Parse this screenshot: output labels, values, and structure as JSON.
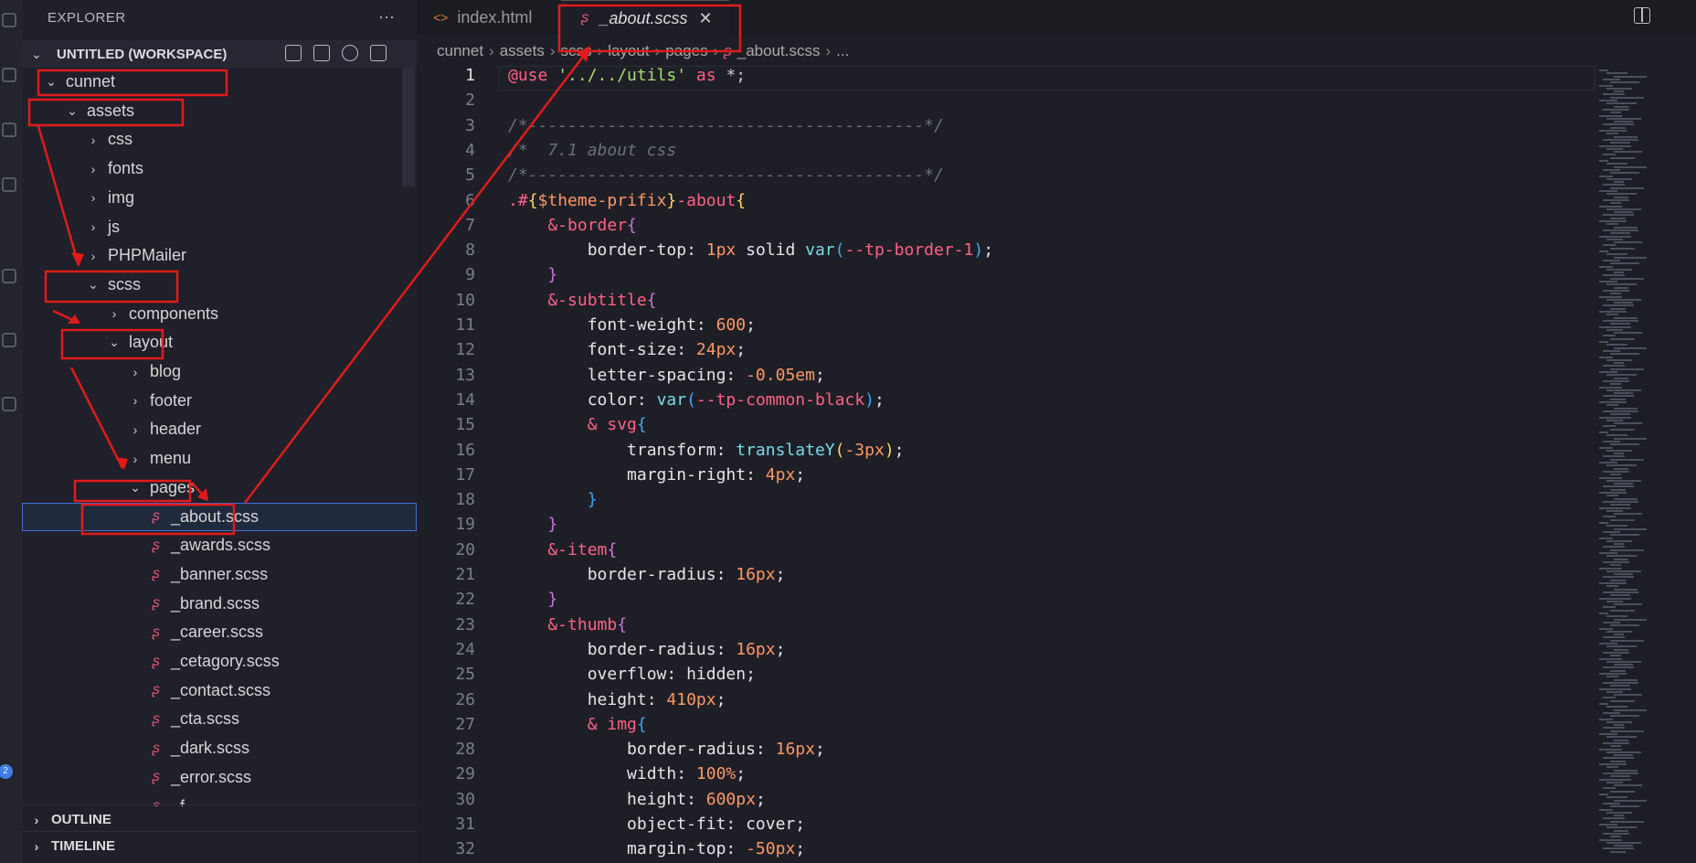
{
  "sidebar": {
    "title": "EXPLORER",
    "more": "···",
    "workspace": "UNTITLED (WORKSPACE)",
    "tree": [
      {
        "label": "cunnet",
        "type": "folder",
        "open": true,
        "depth": 0
      },
      {
        "label": "assets",
        "type": "folder",
        "open": true,
        "depth": 1
      },
      {
        "label": "css",
        "type": "folder",
        "open": false,
        "depth": 2
      },
      {
        "label": "fonts",
        "type": "folder",
        "open": false,
        "depth": 2
      },
      {
        "label": "img",
        "type": "folder",
        "open": false,
        "depth": 2
      },
      {
        "label": "js",
        "type": "folder",
        "open": false,
        "depth": 2
      },
      {
        "label": "PHPMailer",
        "type": "folder",
        "open": false,
        "depth": 2
      },
      {
        "label": "scss",
        "type": "folder",
        "open": true,
        "depth": 2
      },
      {
        "label": "components",
        "type": "folder",
        "open": false,
        "depth": 3
      },
      {
        "label": "layout",
        "type": "folder",
        "open": true,
        "depth": 3
      },
      {
        "label": "blog",
        "type": "folder",
        "open": false,
        "depth": 4
      },
      {
        "label": "footer",
        "type": "folder",
        "open": false,
        "depth": 4
      },
      {
        "label": "header",
        "type": "folder",
        "open": false,
        "depth": 4
      },
      {
        "label": "menu",
        "type": "folder",
        "open": false,
        "depth": 4
      },
      {
        "label": "pages",
        "type": "folder",
        "open": true,
        "depth": 4
      },
      {
        "label": "_about.scss",
        "type": "file",
        "depth": 5,
        "selected": true
      },
      {
        "label": "_awards.scss",
        "type": "file",
        "depth": 5
      },
      {
        "label": "_banner.scss",
        "type": "file",
        "depth": 5
      },
      {
        "label": "_brand.scss",
        "type": "file",
        "depth": 5
      },
      {
        "label": "_career.scss",
        "type": "file",
        "depth": 5
      },
      {
        "label": "_cetagory.scss",
        "type": "file",
        "depth": 5
      },
      {
        "label": "_contact.scss",
        "type": "file",
        "depth": 5
      },
      {
        "label": "_cta.scss",
        "type": "file",
        "depth": 5
      },
      {
        "label": "_dark.scss",
        "type": "file",
        "depth": 5
      },
      {
        "label": "_error.scss",
        "type": "file",
        "depth": 5
      },
      {
        "label": "_f...",
        "type": "file",
        "depth": 5
      }
    ],
    "outline": "OUTLINE",
    "timeline": "TIMELINE",
    "badge": "2"
  },
  "tabs": [
    {
      "label": "index.html",
      "active": false,
      "icon": "html-icon"
    },
    {
      "label": "_about.scss",
      "active": true,
      "icon": "sass-icon"
    }
  ],
  "breadcrumb": [
    "cunnet",
    "assets",
    "scss",
    "layout",
    "pages",
    "_about.scss",
    "..."
  ],
  "editor": {
    "lines": [
      [
        [
          "@use ",
          "c-at"
        ],
        [
          "'../../utils'",
          "c-str"
        ],
        [
          " as ",
          "c-kw"
        ],
        [
          "*",
          "c-op"
        ],
        [
          ";",
          "c-op"
        ]
      ],
      [],
      [
        [
          "/*----------------------------------------*/",
          "c-com"
        ]
      ],
      [
        [
          "/*  7.1 about css",
          "c-com"
        ]
      ],
      [
        [
          "/*----------------------------------------*/",
          "c-com"
        ]
      ],
      [
        [
          ".#",
          "c-sel"
        ],
        [
          "{",
          "c-brace"
        ],
        [
          "$theme-prifix",
          "c-var"
        ],
        [
          "}",
          "c-brace"
        ],
        [
          "-about",
          "c-sel"
        ],
        [
          "{",
          "c-brace"
        ]
      ],
      [
        [
          "    &-border",
          "c-sel"
        ],
        [
          "{",
          "c-brace2"
        ]
      ],
      [
        [
          "        border-top: ",
          "c-prop"
        ],
        [
          "1px",
          "c-num"
        ],
        [
          " solid ",
          "c-prop"
        ],
        [
          "var",
          "c-fn"
        ],
        [
          "(",
          "c-brace3"
        ],
        [
          "--tp-border-1",
          "c-sel"
        ],
        [
          ")",
          "c-brace3"
        ],
        [
          ";",
          "c-prop"
        ]
      ],
      [
        [
          "    ",
          "c-prop"
        ],
        [
          "}",
          "c-brace2"
        ]
      ],
      [
        [
          "    &-subtitle",
          "c-sel"
        ],
        [
          "{",
          "c-brace2"
        ]
      ],
      [
        [
          "        font-weight: ",
          "c-prop"
        ],
        [
          "600",
          "c-num"
        ],
        [
          ";",
          "c-prop"
        ]
      ],
      [
        [
          "        font-size: ",
          "c-prop"
        ],
        [
          "24px",
          "c-num"
        ],
        [
          ";",
          "c-prop"
        ]
      ],
      [
        [
          "        letter-spacing: ",
          "c-prop"
        ],
        [
          "-0.05em",
          "c-num"
        ],
        [
          ";",
          "c-prop"
        ]
      ],
      [
        [
          "        color: ",
          "c-prop"
        ],
        [
          "var",
          "c-fn"
        ],
        [
          "(",
          "c-brace3"
        ],
        [
          "--tp-common-black",
          "c-sel"
        ],
        [
          ")",
          "c-brace3"
        ],
        [
          ";",
          "c-prop"
        ]
      ],
      [
        [
          "        & svg",
          "c-sel"
        ],
        [
          "{",
          "c-brace3"
        ]
      ],
      [
        [
          "            transform: ",
          "c-prop"
        ],
        [
          "translateY",
          "c-fn"
        ],
        [
          "(",
          "c-brace"
        ],
        [
          "-3px",
          "c-num"
        ],
        [
          ")",
          "c-brace"
        ],
        [
          ";",
          "c-prop"
        ]
      ],
      [
        [
          "            margin-right: ",
          "c-prop"
        ],
        [
          "4px",
          "c-num"
        ],
        [
          ";",
          "c-prop"
        ]
      ],
      [
        [
          "        ",
          "c-prop"
        ],
        [
          "}",
          "c-brace3"
        ]
      ],
      [
        [
          "    ",
          "c-prop"
        ],
        [
          "}",
          "c-brace2"
        ]
      ],
      [
        [
          "    &-item",
          "c-sel"
        ],
        [
          "{",
          "c-brace2"
        ]
      ],
      [
        [
          "        border-radius: ",
          "c-prop"
        ],
        [
          "16px",
          "c-num"
        ],
        [
          ";",
          "c-prop"
        ]
      ],
      [
        [
          "    ",
          "c-prop"
        ],
        [
          "}",
          "c-brace2"
        ]
      ],
      [
        [
          "    &-thumb",
          "c-sel"
        ],
        [
          "{",
          "c-brace2"
        ]
      ],
      [
        [
          "        border-radius: ",
          "c-prop"
        ],
        [
          "16px",
          "c-num"
        ],
        [
          ";",
          "c-prop"
        ]
      ],
      [
        [
          "        overflow: hidden;",
          "c-prop"
        ]
      ],
      [
        [
          "        height: ",
          "c-prop"
        ],
        [
          "410px",
          "c-num"
        ],
        [
          ";",
          "c-prop"
        ]
      ],
      [
        [
          "        & img",
          "c-sel"
        ],
        [
          "{",
          "c-brace3"
        ]
      ],
      [
        [
          "            border-radius: ",
          "c-prop"
        ],
        [
          "16px",
          "c-num"
        ],
        [
          ";",
          "c-prop"
        ]
      ],
      [
        [
          "            width: ",
          "c-prop"
        ],
        [
          "100%",
          "c-num"
        ],
        [
          ";",
          "c-prop"
        ]
      ],
      [
        [
          "            height: ",
          "c-prop"
        ],
        [
          "600px",
          "c-num"
        ],
        [
          ";",
          "c-prop"
        ]
      ],
      [
        [
          "            object-fit: cover;",
          "c-prop"
        ]
      ],
      [
        [
          "            margin-top: ",
          "c-prop"
        ],
        [
          "-50px",
          "c-num"
        ],
        [
          ";",
          "c-prop"
        ]
      ]
    ]
  },
  "colors": {
    "annotation": "#e01b1b",
    "accent": "#3f6fd8",
    "sass": "#e0567a"
  }
}
